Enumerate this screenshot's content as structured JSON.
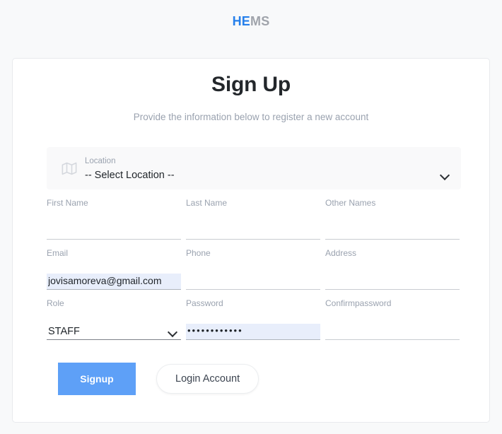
{
  "header": {
    "brand_primary": "HE",
    "brand_secondary": "MS",
    "brand_primary_color": "#2680eb",
    "brand_secondary_color": "#a0a4ab"
  },
  "card": {
    "title": "Sign Up",
    "subtitle": "Provide the information below to register a new account"
  },
  "location": {
    "icon": "map-icon",
    "label": "Location",
    "value": "-- Select Location --",
    "caret_icon": "chevron-down-icon"
  },
  "fields": {
    "first_name": {
      "label": "First Name",
      "value": "",
      "placeholder": ""
    },
    "last_name": {
      "label": "Last Name",
      "value": "",
      "placeholder": ""
    },
    "other_names": {
      "label": "Other Names",
      "value": "",
      "placeholder": ""
    },
    "email": {
      "label": "Email",
      "value": "jovisamoreva@gmail.com",
      "placeholder": ""
    },
    "phone": {
      "label": "Phone",
      "value": "",
      "placeholder": ""
    },
    "address": {
      "label": "Address",
      "value": "",
      "placeholder": ""
    },
    "role": {
      "label": "Role",
      "value": "STAFF",
      "caret_icon": "chevron-down-icon"
    },
    "password": {
      "label": "Password",
      "value": "••••••••••••",
      "placeholder": ""
    },
    "confirm_password": {
      "label": "Confirmpassword",
      "value": "",
      "placeholder": ""
    }
  },
  "actions": {
    "signup_label": "Signup",
    "login_label": "Login Account",
    "signup_color": "#5ea0f7"
  }
}
